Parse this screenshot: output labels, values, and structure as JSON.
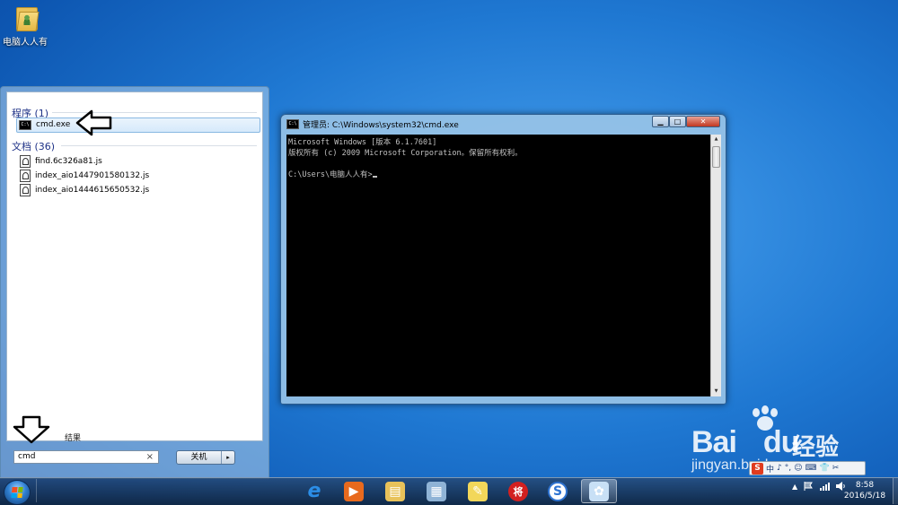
{
  "desktop": {
    "icon_label": "电脑人人有"
  },
  "start_menu": {
    "programs_header": "程序 (1)",
    "programs": [
      {
        "label": "cmd.exe",
        "icon": "cmd-icon"
      }
    ],
    "documents_header": "文档 (36)",
    "documents": [
      {
        "label": "find.6c326a81.js",
        "icon": "script-file-icon"
      },
      {
        "label": "index_aio1447901580132.js",
        "icon": "script-file-icon"
      },
      {
        "label": "index_aio1444615650532.js",
        "icon": "script-file-icon"
      }
    ],
    "more_results": "结果",
    "search_value": "cmd",
    "search_clear": "×",
    "shutdown_label": "关机",
    "shutdown_arrow": "▸"
  },
  "cmd_window": {
    "title": "管理员: C:\\Windows\\system32\\cmd.exe",
    "title_icon": "C:\\",
    "lines": [
      "Microsoft Windows [版本 6.1.7601]",
      "版权所有 (c) 2009 Microsoft Corporation。保留所有权利。",
      "",
      "C:\\Users\\电脑人人有>"
    ],
    "min_glyph": "▁",
    "max_glyph": "□",
    "close_glyph": "✕"
  },
  "watermark": {
    "brand": "Bai",
    "brand2": "du",
    "cn": "经验",
    "url": "jingyan.baidu.com"
  },
  "ime": {
    "logo": "S",
    "lang": "中",
    "symbols": [
      "♪",
      "°,",
      "☺",
      "⌨",
      "👕",
      "✂",
      "⚙"
    ]
  },
  "taskbar": {
    "apps": [
      {
        "name": "internet-explorer-icon",
        "glyph": "e",
        "color": "#2b8ee8"
      },
      {
        "name": "media-player-icon",
        "glyph": "▶",
        "color": "#e86a1e"
      },
      {
        "name": "file-explorer-icon",
        "glyph": "▤",
        "color": "#e8c25a"
      },
      {
        "name": "control-panel-icon",
        "glyph": "▦",
        "color": "#8fb3d6"
      },
      {
        "name": "notes-icon",
        "glyph": "✎",
        "color": "#f2d75a"
      },
      {
        "name": "chess-icon",
        "glyph": "将",
        "color": "#d22020"
      },
      {
        "name": "sogou-browser-icon",
        "glyph": "S",
        "color": "#2f74d2"
      },
      {
        "name": "paint-icon",
        "glyph": "✿",
        "color": "#c8e0f6"
      }
    ],
    "tray_arrow": "▲",
    "time": "8:58",
    "date": "2016/5/18"
  }
}
